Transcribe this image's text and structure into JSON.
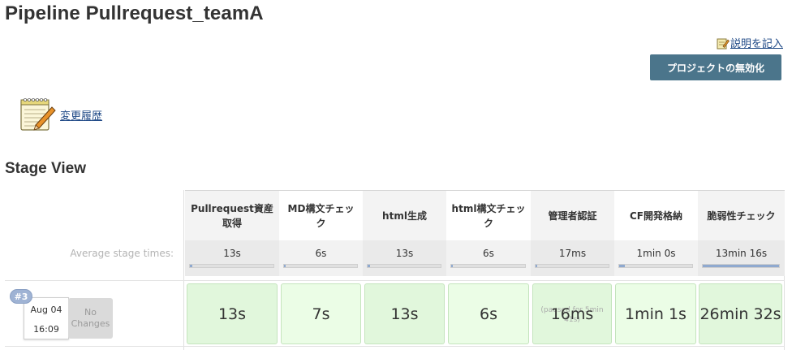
{
  "page": {
    "title": "Pipeline Pullrequest_teamA",
    "edit_description_label": "説明を記入",
    "disable_project_label": "プロジェクトの無効化",
    "changes_label": "変更履歴",
    "stage_view_title": "Stage View"
  },
  "stage_view": {
    "average_label": "Average stage times:",
    "stages": [
      {
        "name": "Pullrequest資産取得",
        "avg": "13s",
        "avg_fraction": 0.03
      },
      {
        "name": "MD構文チェック",
        "avg": "6s",
        "avg_fraction": 0.02
      },
      {
        "name": "html生成",
        "avg": "13s",
        "avg_fraction": 0.03
      },
      {
        "name": "html構文チェック",
        "avg": "6s",
        "avg_fraction": 0.02
      },
      {
        "name": "管理者認証",
        "avg": "17ms",
        "avg_fraction": 0.01
      },
      {
        "name": "CF開発格納",
        "avg": "1min 0s",
        "avg_fraction": 0.08
      },
      {
        "name": "脆弱性チェック",
        "avg": "13min 16s",
        "avg_fraction": 1.0
      }
    ],
    "builds": [
      {
        "number": "#3",
        "date": "Aug 04",
        "time": "16:09",
        "changes": "No Changes",
        "durations": [
          "13s",
          "7s",
          "13s",
          "6s",
          "16ms",
          "1min 1s",
          "26min 32s"
        ],
        "paused_note": "(paused for 5min 41s)"
      }
    ]
  },
  "colors": {
    "link": "#204a87",
    "disable_button": "#4b758b",
    "stage_success": "#e1f7dc",
    "avg_bar_fill": "#8fa9cf",
    "build_badge": "#9fb3d4"
  }
}
